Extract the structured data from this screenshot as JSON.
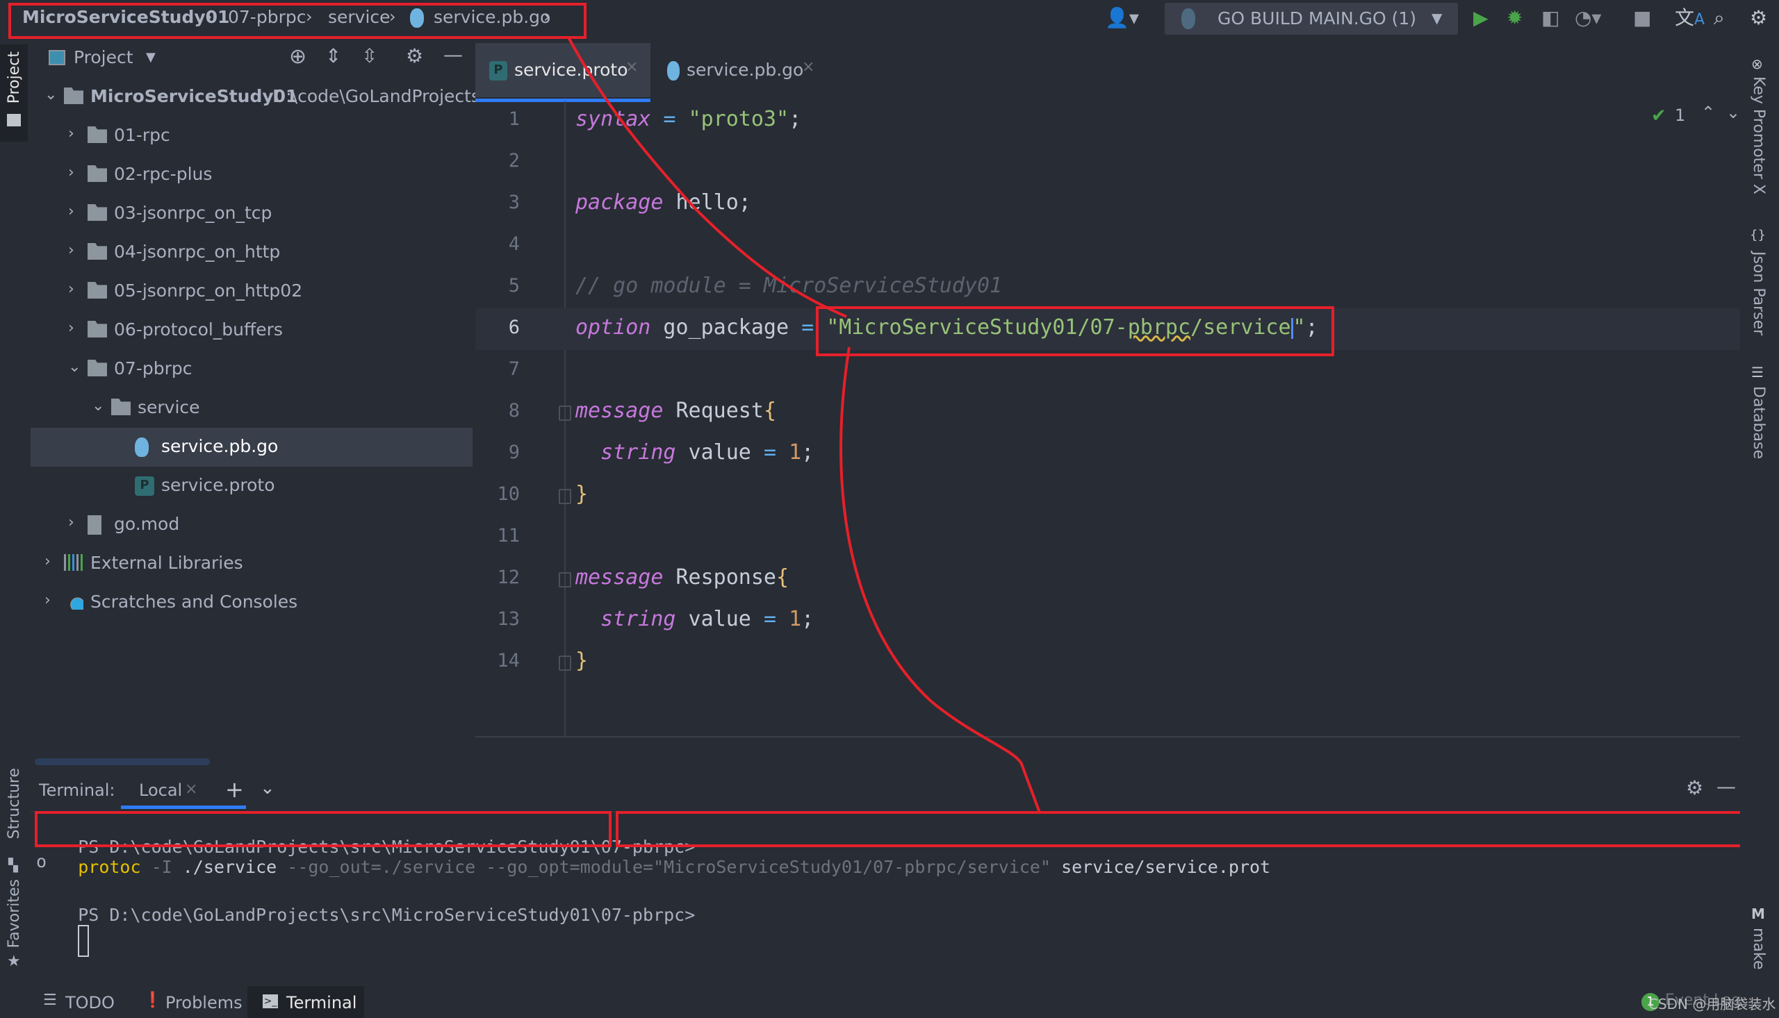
{
  "breadcrumb": {
    "items": [
      "MicroServiceStudy01",
      "07-pbrpc",
      "service",
      "service.pb.go"
    ],
    "separator": "›"
  },
  "toolbar": {
    "run_config_label": "GO BUILD MAIN.GO (1)",
    "icons": [
      "user-icon",
      "run-icon",
      "debug-icon",
      "coverage-icon",
      "profile-icon",
      "stop-icon",
      "translate-icon",
      "search-icon",
      "settings-icon"
    ]
  },
  "left_stripe": {
    "top": "Project",
    "structure": "Structure",
    "favorites": "Favorites"
  },
  "project_panel": {
    "title": "Project",
    "tree": [
      {
        "label": "MicroServiceStudy01",
        "path": "D:\\code\\GoLandProjects\\s",
        "type": "folder",
        "expanded": true,
        "depth": 0
      },
      {
        "label": "01-rpc",
        "type": "folder",
        "expanded": false,
        "depth": 1
      },
      {
        "label": "02-rpc-plus",
        "type": "folder",
        "expanded": false,
        "depth": 1
      },
      {
        "label": "03-jsonrpc_on_tcp",
        "type": "folder",
        "expanded": false,
        "depth": 1
      },
      {
        "label": "04-jsonrpc_on_http",
        "type": "folder",
        "expanded": false,
        "depth": 1
      },
      {
        "label": "05-jsonrpc_on_http02",
        "type": "folder",
        "expanded": false,
        "depth": 1
      },
      {
        "label": "06-protocol_buffers",
        "type": "folder",
        "expanded": false,
        "depth": 1
      },
      {
        "label": "07-pbrpc",
        "type": "folder",
        "expanded": true,
        "depth": 1
      },
      {
        "label": "service",
        "type": "folder",
        "expanded": true,
        "depth": 2
      },
      {
        "label": "service.pb.go",
        "type": "go",
        "selected": true,
        "depth": 3
      },
      {
        "label": "service.proto",
        "type": "proto",
        "depth": 3
      },
      {
        "label": "go.mod",
        "type": "mod",
        "expanded": false,
        "depth": 1
      },
      {
        "label": "External Libraries",
        "type": "libs",
        "expanded": false,
        "depth": 0
      },
      {
        "label": "Scratches and Consoles",
        "type": "scratches",
        "expanded": false,
        "depth": 0
      }
    ]
  },
  "editor": {
    "tabs": [
      {
        "label": "service.proto",
        "active": true,
        "icon": "proto-file-icon"
      },
      {
        "label": "service.pb.go",
        "active": false,
        "icon": "go-file-icon"
      }
    ],
    "inspection_count": "1",
    "current_line": 6,
    "lines": [
      {
        "n": "1",
        "tokens": [
          {
            "t": "syntax",
            "c": "kw"
          },
          {
            "t": " = ",
            "c": "op"
          },
          {
            "t": "\"proto3\"",
            "c": "str"
          },
          {
            "t": ";",
            "c": ""
          }
        ]
      },
      {
        "n": "2",
        "tokens": []
      },
      {
        "n": "3",
        "tokens": [
          {
            "t": "package",
            "c": "kw"
          },
          {
            "t": " hello;",
            "c": ""
          }
        ]
      },
      {
        "n": "4",
        "tokens": []
      },
      {
        "n": "5",
        "tokens": [
          {
            "t": "// go module = MicroServiceStudy01",
            "c": "cmt"
          }
        ]
      },
      {
        "n": "6",
        "tokens": [
          {
            "t": "option",
            "c": "kw"
          },
          {
            "t": " go_package ",
            "c": ""
          },
          {
            "t": "=",
            "c": "op"
          },
          {
            "t": " ",
            "c": ""
          },
          {
            "t": "\"MicroServiceStudy01/07-",
            "c": "str"
          },
          {
            "t": "pbrpc",
            "c": "str warn"
          },
          {
            "t": "/service",
            "c": "str"
          },
          {
            "t": "",
            "c": "caret"
          },
          {
            "t": "\"",
            "c": "str"
          },
          {
            "t": ";",
            "c": ""
          }
        ]
      },
      {
        "n": "7",
        "tokens": []
      },
      {
        "n": "8",
        "tokens": [
          {
            "t": "message",
            "c": "kw"
          },
          {
            "t": " Request",
            "c": ""
          },
          {
            "t": "{",
            "c": "brace"
          }
        ]
      },
      {
        "n": "9",
        "tokens": [
          {
            "t": "  ",
            "c": ""
          },
          {
            "t": "string",
            "c": "kw"
          },
          {
            "t": " value ",
            "c": ""
          },
          {
            "t": "=",
            "c": "op"
          },
          {
            "t": " ",
            "c": ""
          },
          {
            "t": "1",
            "c": "num"
          },
          {
            "t": ";",
            "c": ""
          }
        ]
      },
      {
        "n": "10",
        "tokens": [
          {
            "t": "}",
            "c": "brace"
          }
        ]
      },
      {
        "n": "11",
        "tokens": []
      },
      {
        "n": "12",
        "tokens": [
          {
            "t": "message",
            "c": "kw"
          },
          {
            "t": " Response",
            "c": ""
          },
          {
            "t": "{",
            "c": "brace"
          }
        ]
      },
      {
        "n": "13",
        "tokens": [
          {
            "t": "  ",
            "c": ""
          },
          {
            "t": "string",
            "c": "kw"
          },
          {
            "t": " value ",
            "c": ""
          },
          {
            "t": "=",
            "c": "op"
          },
          {
            "t": " ",
            "c": ""
          },
          {
            "t": "1",
            "c": "num"
          },
          {
            "t": ";",
            "c": ""
          }
        ]
      },
      {
        "n": "14",
        "tokens": [
          {
            "t": "}",
            "c": "brace"
          }
        ]
      }
    ]
  },
  "right_stripe": {
    "items": [
      "Key Promoter X",
      "Json Parser",
      "Database",
      "make"
    ]
  },
  "terminal": {
    "label": "Terminal:",
    "tab": "Local",
    "prompt": "PS D:\\code\\GoLandProjects\\src\\MicroServiceStudy01\\07-pbrpc>",
    "command_tokens": [
      {
        "t": "protoc",
        "c": "t-cmd"
      },
      {
        "t": " -I ",
        "c": "t-dim"
      },
      {
        "t": "./service",
        "c": "t-arg"
      },
      {
        "t": " --go_out=./service --go_opt=module=\"MicroServiceStudy01/07-pbrpc/service\" ",
        "c": "t-dim"
      },
      {
        "t": "service/service.prot",
        "c": "t-arg"
      }
    ],
    "wrap_line": "o",
    "prompt2": "PS D:\\code\\GoLandProjects\\src\\MicroServiceStudy01\\07-pbrpc>"
  },
  "bottom_bar": {
    "tabs": [
      {
        "label": "TODO",
        "icon": "list-icon"
      },
      {
        "label": "Problems",
        "icon": "problems-icon"
      },
      {
        "label": "Terminal",
        "icon": "terminal-icon",
        "active": true
      }
    ],
    "event_log_count": "1",
    "event_log_label": "Event Log",
    "watermark": "CSDN @用脑袋装水"
  },
  "annotation_color": "#e5202a"
}
